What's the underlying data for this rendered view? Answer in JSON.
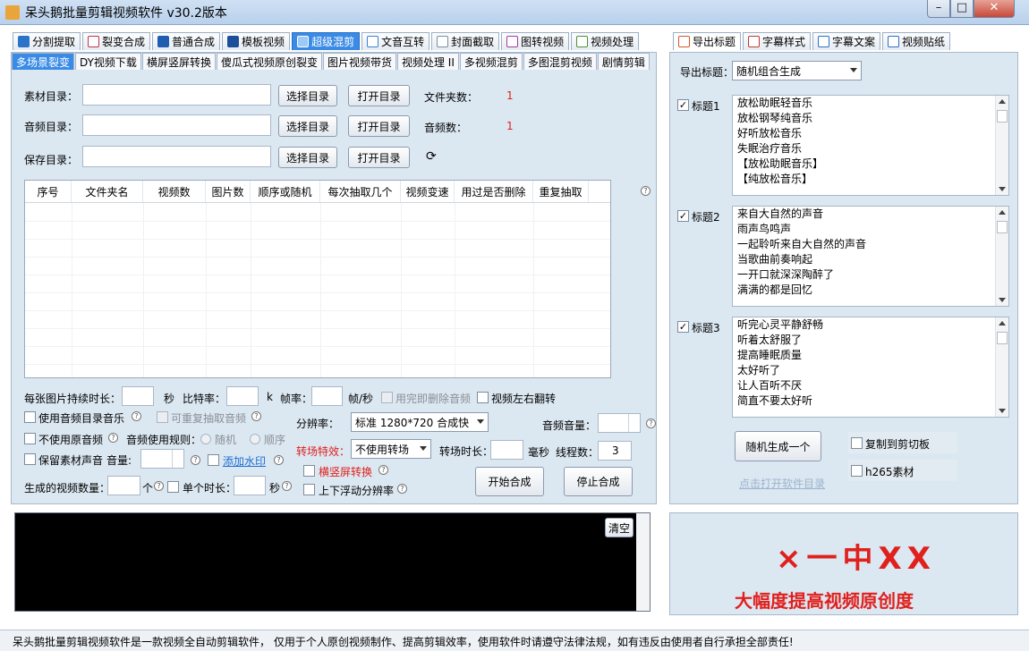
{
  "window": {
    "title": "呆头鹅批量剪辑视频软件   v30.2版本",
    "min_label": "–",
    "max_label": "□",
    "close_label": "✕"
  },
  "main_tabs": [
    {
      "label": "分割提取",
      "icon": "play-icon"
    },
    {
      "label": "裂变合成",
      "icon": "copy-icon"
    },
    {
      "label": "普通合成",
      "icon": "play-icon"
    },
    {
      "label": "模板视频",
      "icon": "template-icon"
    },
    {
      "label": "超级混剪",
      "icon": "waveform-icon",
      "active": true
    },
    {
      "label": "文音互转",
      "icon": "microphone-icon"
    },
    {
      "label": "封面截取",
      "icon": "image-icon"
    },
    {
      "label": "图转视频",
      "icon": "slideshow-icon"
    },
    {
      "label": "视频处理",
      "icon": "film-icon"
    }
  ],
  "sub_tabs": [
    {
      "label": "多场景裂变",
      "active": true
    },
    {
      "label": "DY视频下载"
    },
    {
      "label": "横屏竖屏转换"
    },
    {
      "label": "傻瓜式视频原创裂变"
    },
    {
      "label": "图片视频带货"
    },
    {
      "label": "视频处理 II"
    },
    {
      "label": "多视频混剪"
    },
    {
      "label": "多图混剪视频"
    },
    {
      "label": "剧情剪辑"
    }
  ],
  "form": {
    "material_dir_label": "素材目录：",
    "audio_dir_label": "音频目录：",
    "save_dir_label": "保存目录：",
    "select_dir_button": "选择目录",
    "open_dir_button": "打开目录",
    "folder_count_label": "文件夹数：",
    "folder_count_value": "1",
    "audio_count_label": "音频数：",
    "audio_count_value": "1"
  },
  "grid": {
    "columns": [
      "序号",
      "文件夹名",
      "视频数",
      "图片数",
      "顺序或随机",
      "每次抽取几个",
      "视频变速",
      "用过是否删除",
      "重复抽取"
    ]
  },
  "options": {
    "img_duration_label": "每张图片持续时长：",
    "sec_unit": "秒",
    "bitrate_label": "比特率：",
    "bitrate_unit": "k",
    "framerate_label": "帧率：",
    "framerate_unit": "帧/秒",
    "delete_audio_label": "用完即删除音频",
    "flip_label": "视频左右翻转",
    "use_audio_dir_label": "使用音频目录音乐",
    "repeat_audio_label": "可重复抽取音频",
    "resolution_label": "分辨率：",
    "resolution_value": "标准 1280*720 合成快",
    "audio_volume_label": "音频音量：",
    "no_orig_audio_label": "不使用原音频",
    "audio_rule_label": "音频使用规则：",
    "random_label": "随机",
    "order_label": "顺序",
    "transition_label": "转场特效：",
    "transition_value": "不使用转场",
    "transition_time_label": "转场时长：",
    "ms_unit": "毫秒",
    "threads_label": "线程数：",
    "threads_value": "3",
    "keep_material_audio_label": "保留素材声音",
    "volume_label": "音量:",
    "watermark_label": "添加水印",
    "orientation_label": "横竖屏转换",
    "float_res_label": "上下浮动分辨率",
    "video_count_label": "生成的视频数量：",
    "count_unit": "个",
    "single_duration_label": "单个时长：",
    "start_button": "开始合成",
    "stop_button": "停止合成",
    "clear_button": "清空"
  },
  "right_tabs": [
    {
      "label": "导出标题",
      "icon": "export-icon",
      "active": true
    },
    {
      "label": "字幕样式",
      "icon": "subtitle-style-icon"
    },
    {
      "label": "字幕文案",
      "icon": "subtitle-text-icon"
    },
    {
      "label": "视频贴纸",
      "icon": "sticker-icon"
    }
  ],
  "right": {
    "export_title_label": "导出标题：",
    "export_mode": "随机组合生成",
    "title_groups": [
      {
        "label": "标题1",
        "checked": true,
        "lines": [
          "放松助眠轻音乐",
          "放松钢琴纯音乐",
          "好听放松音乐",
          "失眠治疗音乐",
          "【放松助眠音乐】",
          "【纯放松音乐】"
        ]
      },
      {
        "label": "标题2",
        "checked": true,
        "lines": [
          "来自大自然的声音",
          "雨声鸟鸣声",
          "一起聆听来自大自然的声音",
          "当歌曲前奏响起",
          "一开口就深深陶醉了",
          "满满的都是回忆"
        ]
      },
      {
        "label": "标题3",
        "checked": true,
        "lines": [
          "听完心灵平静舒畅",
          "听着太舒服了",
          "提高睡眠质量",
          "太好听了",
          "让人百听不厌",
          "简直不要太好听"
        ]
      }
    ],
    "random_generate_button": "随机生成一个",
    "copy_clipboard_label": "复制到剪切板",
    "h265_label": "h265素材",
    "open_dir_link": "点击打开软件目录"
  },
  "preview": {
    "partial_text": "×一中XX",
    "caption": "大幅度提高视频原创度",
    "color": "#e0201d"
  },
  "status": {
    "text": "呆头鹅批量剪辑视频软件是一款视频全自动剪辑软件， 仅用于个人原创视频制作、提高剪辑效率，使用软件时请遵守法律法规，如有违反由使用者自行承担全部责任!"
  }
}
